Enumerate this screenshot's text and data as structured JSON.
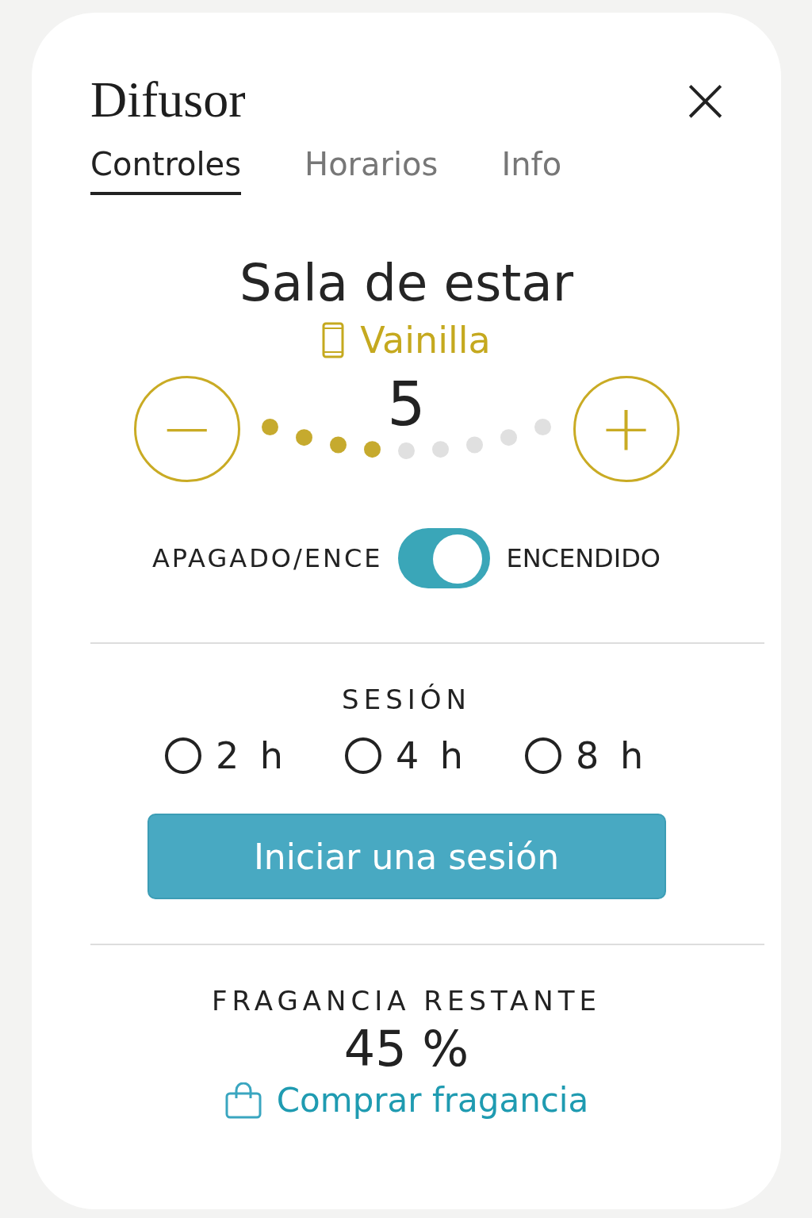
{
  "header": {
    "title": "Difusor",
    "close": "×"
  },
  "tabs": [
    {
      "label": "Controles",
      "selected": true
    },
    {
      "label": "Horarios",
      "selected": false
    },
    {
      "label": "Info",
      "selected": false
    }
  ],
  "device": {
    "room": "Sala de estar",
    "fragrance": "Vainilla"
  },
  "intensity": {
    "value": "5",
    "minus": "−",
    "plus": "+",
    "dots": [
      {
        "on": true
      },
      {
        "on": true
      },
      {
        "on": true
      },
      {
        "on": true
      },
      {
        "on": false
      },
      {
        "on": false
      },
      {
        "on": false
      },
      {
        "on": false
      },
      {
        "on": false
      }
    ]
  },
  "power": {
    "label_left": "APAGADO/ENCE",
    "label_right": "ENCENDIDO",
    "on": true
  },
  "session": {
    "title": "SESIÓN",
    "options": [
      {
        "label": "2 h",
        "selected": false
      },
      {
        "label": "4 h",
        "selected": false
      },
      {
        "label": "8 h",
        "selected": false
      }
    ],
    "button": "Iniciar una sesión"
  },
  "fragrance_left": {
    "title": "FRAGANCIA RESTANTE",
    "value": "45 %",
    "link": "Comprar fragancia"
  }
}
